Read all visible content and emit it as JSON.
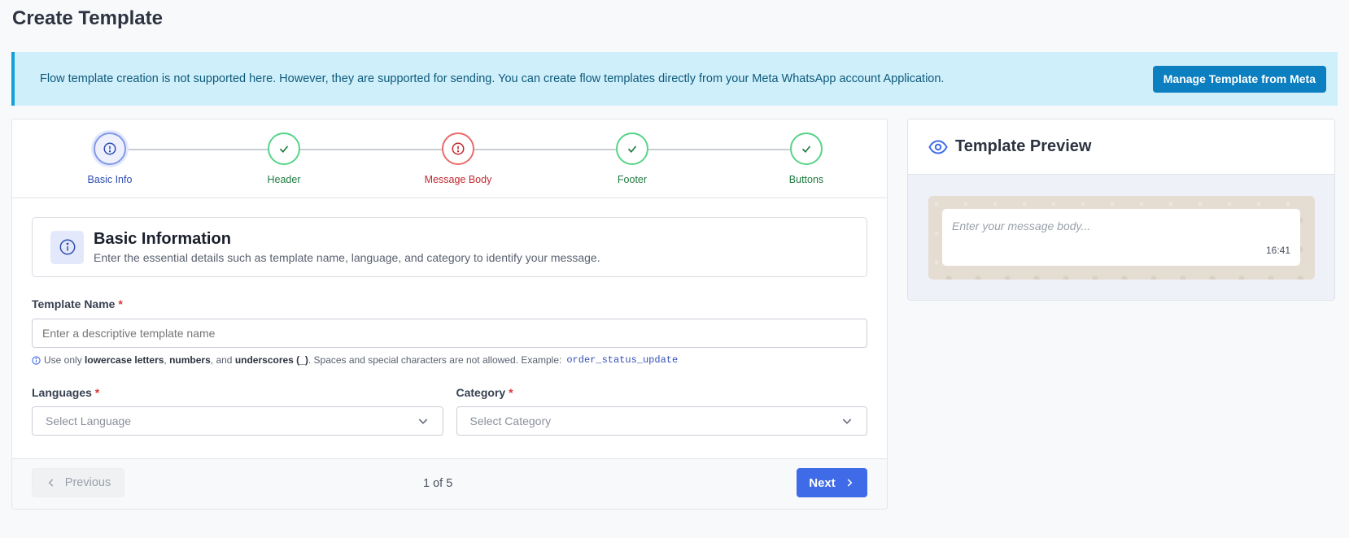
{
  "page": {
    "title": "Create Template"
  },
  "alert": {
    "text": "Flow template creation is not supported here. However, they are supported for sending. You can create flow templates directly from your Meta WhatsApp account Application.",
    "button_label": "Manage Template from Meta"
  },
  "steps": [
    {
      "label": "Basic Info",
      "state": "current",
      "icon": "alert-circle-icon"
    },
    {
      "label": "Header",
      "state": "complete",
      "icon": "check-icon"
    },
    {
      "label": "Message Body",
      "state": "error",
      "icon": "alert-circle-icon"
    },
    {
      "label": "Footer",
      "state": "complete",
      "icon": "check-icon"
    },
    {
      "label": "Buttons",
      "state": "complete",
      "icon": "check-icon"
    }
  ],
  "basic_info": {
    "title": "Basic Information",
    "description": "Enter the essential details such as template name, language, and category to identify your message."
  },
  "template_name": {
    "label": "Template Name",
    "required_mark": "*",
    "placeholder": "Enter a descriptive template name",
    "hint_parts": {
      "a": "Use only ",
      "b": "lowercase letters",
      "c": ", ",
      "d": "numbers",
      "e": ", and ",
      "f": "underscores (_)",
      "g": ". Spaces and special characters are not allowed. Example:",
      "example": "order_status_update"
    }
  },
  "languages": {
    "label": "Languages",
    "required_mark": "*",
    "placeholder": "Select Language"
  },
  "category": {
    "label": "Category",
    "required_mark": "*",
    "placeholder": "Select Category"
  },
  "pager": {
    "previous_label": "Previous",
    "count": "1 of 5",
    "next_label": "Next"
  },
  "preview": {
    "title": "Template Preview",
    "message_placeholder": "Enter your message body...",
    "time": "16:41"
  },
  "colors": {
    "primary": "#3f6be8",
    "alert_bg": "#cfeffb",
    "meta_button": "#0c7fc0",
    "success": "#56d488",
    "error": "#e86b6b"
  }
}
